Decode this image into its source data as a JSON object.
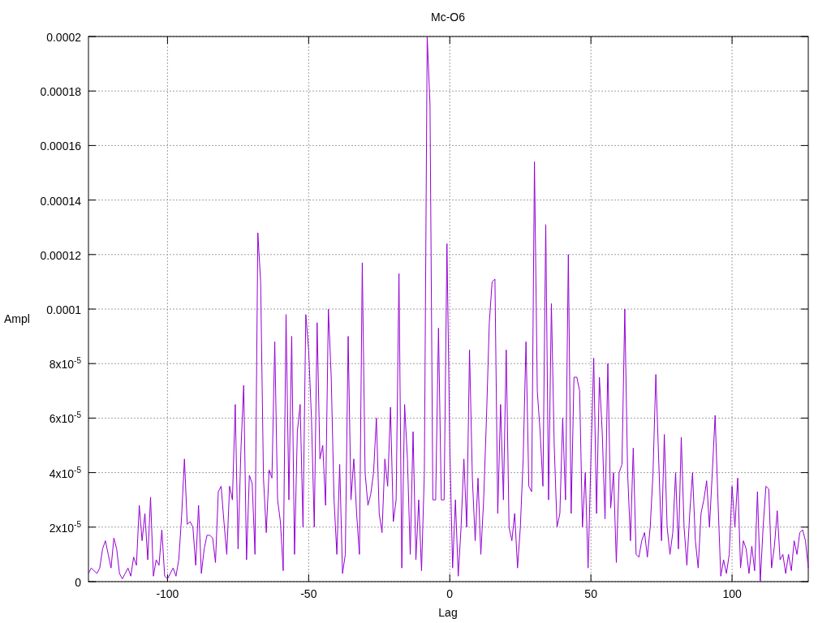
{
  "chart_data": {
    "type": "line",
    "title": "Mc-O6",
    "xlabel": "Lag",
    "ylabel": "Ampl",
    "xlim": [
      -128,
      127
    ],
    "ylim": [
      0,
      0.0002
    ],
    "grid": true,
    "xticks": [
      -100,
      -50,
      0,
      50,
      100
    ],
    "yticks": [
      {
        "value": 0,
        "label": "0"
      },
      {
        "value": 2e-05,
        "label": "2x10$^{-5}$"
      },
      {
        "value": 4e-05,
        "label": "4x10$^{-5}$"
      },
      {
        "value": 6e-05,
        "label": "6x10$^{-5}$"
      },
      {
        "value": 8e-05,
        "label": "8x10$^{-5}$"
      },
      {
        "value": 0.0001,
        "label": "0.0001"
      },
      {
        "value": 0.00012,
        "label": "0.00012"
      },
      {
        "value": 0.00014,
        "label": "0.00014"
      },
      {
        "value": 0.00016,
        "label": "0.00016"
      },
      {
        "value": 0.00018,
        "label": "0.00018"
      },
      {
        "value": 0.0002,
        "label": "0.0002"
      }
    ],
    "x": [
      -128,
      -127,
      -126,
      -125,
      -124,
      -123,
      -122,
      -121,
      -120,
      -119,
      -118,
      -117,
      -116,
      -115,
      -114,
      -113,
      -112,
      -111,
      -110,
      -109,
      -108,
      -107,
      -106,
      -105,
      -104,
      -103,
      -102,
      -101,
      -100,
      -99,
      -98,
      -97,
      -96,
      -95,
      -94,
      -93,
      -92,
      -91,
      -90,
      -89,
      -88,
      -87,
      -86,
      -85,
      -84,
      -83,
      -82,
      -81,
      -80,
      -79,
      -78,
      -77,
      -76,
      -75,
      -74,
      -73,
      -72,
      -71,
      -70,
      -69,
      -68,
      -67,
      -66,
      -65,
      -64,
      -63,
      -62,
      -61,
      -60,
      -59,
      -58,
      -57,
      -56,
      -55,
      -54,
      -53,
      -52,
      -51,
      -50,
      -49,
      -48,
      -47,
      -46,
      -45,
      -44,
      -43,
      -42,
      -41,
      -40,
      -39,
      -38,
      -37,
      -36,
      -35,
      -34,
      -33,
      -32,
      -31,
      -30,
      -29,
      -28,
      -27,
      -26,
      -25,
      -24,
      -23,
      -22,
      -21,
      -20,
      -19,
      -18,
      -17,
      -16,
      -15,
      -14,
      -13,
      -12,
      -11,
      -10,
      -9,
      -8,
      -7,
      -6,
      -5,
      -4,
      -3,
      -2,
      -1,
      0,
      1,
      2,
      3,
      4,
      5,
      6,
      7,
      8,
      9,
      10,
      11,
      12,
      13,
      14,
      15,
      16,
      17,
      18,
      19,
      20,
      21,
      22,
      23,
      24,
      25,
      26,
      27,
      28,
      29,
      30,
      31,
      32,
      33,
      34,
      35,
      36,
      37,
      38,
      39,
      40,
      41,
      42,
      43,
      44,
      45,
      46,
      47,
      48,
      49,
      50,
      51,
      52,
      53,
      54,
      55,
      56,
      57,
      58,
      59,
      60,
      61,
      62,
      63,
      64,
      65,
      66,
      67,
      68,
      69,
      70,
      71,
      72,
      73,
      74,
      75,
      76,
      77,
      78,
      79,
      80,
      81,
      82,
      83,
      84,
      85,
      86,
      87,
      88,
      89,
      90,
      91,
      92,
      93,
      94,
      95,
      96,
      97,
      98,
      99,
      100,
      101,
      102,
      103,
      104,
      105,
      106,
      107,
      108,
      109,
      110,
      111,
      112,
      113,
      114,
      115,
      116,
      117,
      118,
      119,
      120,
      121,
      122,
      123,
      124,
      125,
      126,
      127
    ],
    "series": [
      {
        "color": "#9400d3",
        "values": [
          3e-06,
          5e-06,
          4e-06,
          3e-06,
          5e-06,
          1.2e-05,
          1.5e-05,
          1e-05,
          5e-06,
          1.6e-05,
          1.2e-05,
          3e-06,
          1e-06,
          3e-06,
          5e-06,
          2e-06,
          9e-06,
          6e-06,
          2.8e-05,
          1.5e-05,
          2.5e-05,
          8e-06,
          3.1e-05,
          2e-06,
          8e-06,
          6e-06,
          1.9e-05,
          2e-06,
          1e-06,
          3e-06,
          5e-06,
          2e-06,
          8e-06,
          2.4e-05,
          4.5e-05,
          2.1e-05,
          2.2e-05,
          2e-05,
          6e-06,
          2.8e-05,
          3e-06,
          1.2e-05,
          1.7e-05,
          1.7e-05,
          1.6e-05,
          7e-06,
          3.3e-05,
          3.5e-05,
          2.2e-05,
          1e-05,
          3.5e-05,
          3e-05,
          6.5e-05,
          1.2e-05,
          4.8e-05,
          7.2e-05,
          8e-06,
          3.9e-05,
          3.6e-05,
          1e-05,
          0.000128,
          0.00011,
          3.8e-05,
          1.8e-05,
          4.1e-05,
          3.8e-05,
          8.8e-05,
          3e-05,
          2.2e-05,
          4e-06,
          9.8e-05,
          3e-05,
          9e-05,
          1e-05,
          5.5e-05,
          6.5e-05,
          2e-05,
          9.8e-05,
          8.5e-05,
          6e-05,
          2e-05,
          9.5e-05,
          4.5e-05,
          5e-05,
          2.8e-05,
          0.0001,
          7.5e-05,
          3e-05,
          1e-05,
          4.3e-05,
          3e-06,
          1e-05,
          9e-05,
          3e-05,
          4.5e-05,
          2.5e-05,
          1e-05,
          0.000117,
          4e-05,
          2.8e-05,
          3.2e-05,
          4e-05,
          6e-05,
          2.5e-05,
          1.8e-05,
          4.5e-05,
          3.5e-05,
          6.4e-05,
          2.2e-05,
          3e-05,
          0.000113,
          5e-06,
          6.5e-05,
          4.5e-05,
          1e-05,
          5.5e-05,
          8e-06,
          3e-05,
          4e-06,
          4e-05,
          0.0002,
          0.000175,
          3e-05,
          3e-05,
          9.3e-05,
          3e-05,
          3e-05,
          0.000124,
          5e-05,
          5e-06,
          3e-05,
          2e-06,
          2e-05,
          4.5e-05,
          2e-05,
          8.5e-05,
          3.8e-05,
          1.5e-05,
          3.8e-05,
          1e-05,
          3e-05,
          6e-05,
          9.5e-05,
          0.00011,
          0.000111,
          2.5e-05,
          6.5e-05,
          3e-05,
          8.5e-05,
          2e-05,
          1.5e-05,
          2.5e-05,
          5e-06,
          2e-05,
          4.5e-05,
          8.8e-05,
          3.5e-05,
          3.3e-05,
          0.000154,
          7e-05,
          5.5e-05,
          3.5e-05,
          0.000131,
          3e-05,
          0.000102,
          5e-05,
          2e-05,
          2.5e-05,
          6e-05,
          3e-05,
          0.00012,
          2.5e-05,
          7.5e-05,
          7.5e-05,
          7e-05,
          2e-05,
          4e-05,
          5e-06,
          4.5e-05,
          8.2e-05,
          2.5e-05,
          7.5e-05,
          5.5e-05,
          2.3e-05,
          8e-05,
          2.7e-05,
          4e-05,
          7e-06,
          4e-05,
          4.3e-05,
          0.0001,
          4e-05,
          1.5e-05,
          4.9e-05,
          1e-05,
          9e-06,
          1.5e-05,
          1.8e-05,
          9e-06,
          2e-05,
          4e-05,
          7.6e-05,
          4.5e-05,
          1.5e-05,
          5.4e-05,
          2e-05,
          1e-05,
          1.8e-05,
          4e-05,
          1.2e-05,
          5.3e-05,
          2e-05,
          6e-06,
          2.5e-05,
          4e-05,
          1.5e-05,
          5e-06,
          2.5e-05,
          3e-05,
          3.7e-05,
          2e-05,
          4e-05,
          6.1e-05,
          3e-05,
          2e-06,
          8e-06,
          3e-06,
          1e-05,
          3.5e-05,
          2e-05,
          3.8e-05,
          5e-06,
          1.5e-05,
          1.2e-05,
          3e-06,
          1.3e-05,
          4e-06,
          3.3e-05,
          0.0,
          2e-05,
          3.5e-05,
          3.4e-05,
          5e-06,
          1.3e-05,
          2.6e-05,
          8e-06,
          1e-05,
          3e-06,
          1e-05,
          4e-06,
          1.5e-05,
          1e-05,
          1.8e-05,
          1.9e-05,
          1.5e-05,
          5e-06
        ]
      }
    ]
  }
}
